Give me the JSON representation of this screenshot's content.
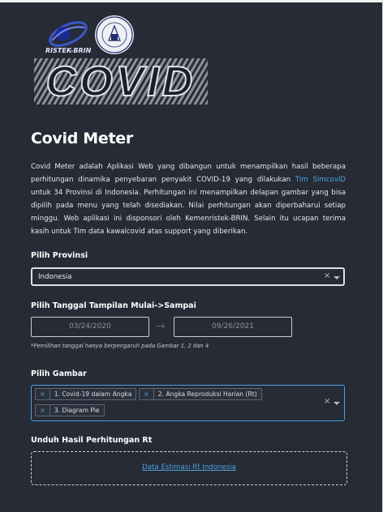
{
  "logos": {
    "ristek": "RISTEK-BRIN",
    "itb": "INSTITUT TEKNOLOGI BANDUNG 1920",
    "covid": "COVID"
  },
  "title": "Covid Meter",
  "description": {
    "part1": "Covid Meter adalah Aplikasi Web yang dibangun untuk menampilkan hasil beberapa perhitungan dinamika penyebaran penyakit COVID-19 yang dilakukan ",
    "link": "Tim SimcovID",
    "part2": " untuk 34 Provinsi di Indonesia. Perhitungan ini menampilkan delapan gambar yang bisa dipilih pada menu yang telah disediakan. Nilai perhitungan akan diperbaharui setiap minggu. Web aplikasi ini disponsori oleh Kemenristek-BRIN. Selain itu ucapan terima kasih untuk Tim data kawalcovid atas support yang diberikan."
  },
  "provinsi": {
    "label": "Pilih Provinsi",
    "value": "Indonesia",
    "clear": "×"
  },
  "tanggal": {
    "label": "Pilih Tanggal Tampilan Mulai->Sampai",
    "start": "03/24/2020",
    "end": "09/26/2021",
    "arrow": "→",
    "note": "*Pemilihan tanggal hanya berpengaruh pada Gambar 1, 2 dan 4"
  },
  "gambar": {
    "label": "Pilih Gambar",
    "clear": "×",
    "remove": "×",
    "chips": [
      "1. Covid-19 dalam Angka",
      "2. Angka Reproduksi Harian (Rt)",
      "3. Diagram Pie"
    ]
  },
  "unduh": {
    "label": "Unduh Hasil Perhitungan Rt",
    "link": "Data Estimasi Rt Indonesia"
  },
  "colors": {
    "background": "#262b35",
    "accent": "#4aa3df"
  }
}
